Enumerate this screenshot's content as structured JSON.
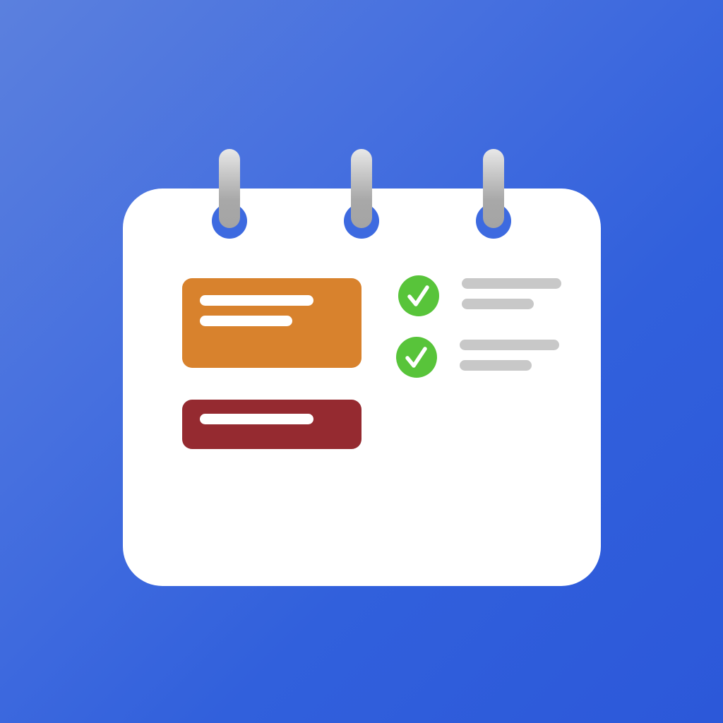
{
  "app_icon": {
    "name": "calendar-checklist-app-icon",
    "colors": {
      "background_light": "#5b80de",
      "background_dark": "#2c58d9",
      "card": "#ffffff",
      "ring_hole": "#3d6ae0",
      "ring_rod": "#a8a8a8",
      "event_orange": "#d8822d",
      "event_red": "#952a30",
      "check_green": "#58c43a",
      "placeholder_gray": "#c8c8c8"
    },
    "binder_rings": [
      "ring-icon",
      "ring-icon",
      "ring-icon"
    ],
    "event_blocks": [
      {
        "color": "#d8822d",
        "text_lines": 2
      },
      {
        "color": "#952a30",
        "text_lines": 1
      }
    ],
    "checklist_items": [
      {
        "icon": "check-circle-icon",
        "checked": true,
        "text_lines": 2
      },
      {
        "icon": "check-circle-icon",
        "checked": true,
        "text_lines": 2
      }
    ]
  }
}
